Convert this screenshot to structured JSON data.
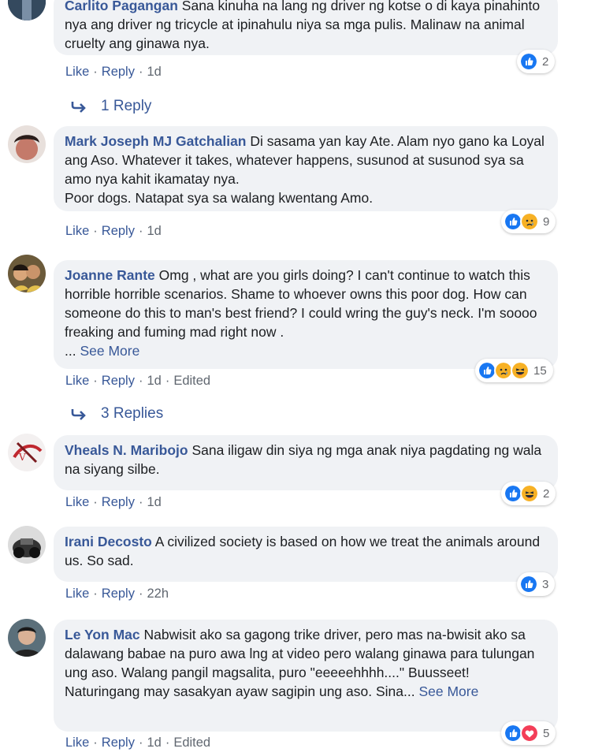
{
  "comments": [
    {
      "author": "Carlito Pagangan",
      "text": "Sana kinuha na lang ng driver ng kotse o di kaya pinahinto nya ang driver ng tricycle at ipinahulu niya sa mga pulis. Malinaw na animal cruelty ang ginawa nya.",
      "like": "Like",
      "reply": "Reply",
      "time": "1d",
      "reaction_count": "2",
      "replies_label": "1 Reply"
    },
    {
      "author": "Mark Joseph MJ Gatchalian",
      "text": "Di sasama yan kay Ate. Alam nyo gano ka Loyal ang Aso. Whatever it takes, whatever happens, susunod at susunod sya sa amo nya kahit ikamatay nya.",
      "text2": "Poor dogs. Natapat sya sa walang kwentang Amo.",
      "like": "Like",
      "reply": "Reply",
      "time": "1d",
      "reaction_count": "9"
    },
    {
      "author": "Joanne Rante",
      "text": "Omg , what are you girls doing? I can't continue to watch this horrible horrible scenarios. Shame to whoever owns this poor dog. How can someone do this to man's best friend? I could wring the guy's neck. I'm soooo freaking and fuming mad right now .",
      "ellipsis": "...",
      "see_more": "See More",
      "like": "Like",
      "reply": "Reply",
      "time": "1d",
      "edited": "Edited",
      "reaction_count": "15",
      "replies_label": "3 Replies"
    },
    {
      "author": "Vheals N. Maribojo",
      "text": "Sana iligaw din siya ng mga anak niya pagdating ng wala na siyang silbe.",
      "like": "Like",
      "reply": "Reply",
      "time": "1d",
      "reaction_count": "2"
    },
    {
      "author": "Irani Decosto",
      "text": "A civilized society is based on how we treat the animals around us. So sad.",
      "like": "Like",
      "reply": "Reply",
      "time": "22h",
      "reaction_count": "3"
    },
    {
      "author": "Le Yon Mac",
      "text": "Nabwisit ako sa gagong trike driver, pero mas na-bwisit ako sa dalawang babae na puro awa lng at video pero walang ginawa para tulungan ung aso. Walang pangil magsalita, puro \"eeeeehhhh....\" Buusseet! Naturingang may sasakyan ayaw sagipin ung aso. Sina...",
      "see_more": "See More",
      "like": "Like",
      "reply": "Reply",
      "time": "1d",
      "edited": "Edited",
      "reaction_count": "5"
    }
  ],
  "colors": {
    "link": "#385898",
    "meta": "#606770",
    "bubble": "#f0f2f5",
    "like_blue": "#1877f2",
    "haha_yellow": "#f7b125",
    "love_red": "#f33e58"
  },
  "icons": [
    "like-reaction-icon",
    "sad-reaction-icon",
    "haha-reaction-icon",
    "love-reaction-icon",
    "reply-arrow-icon"
  ]
}
